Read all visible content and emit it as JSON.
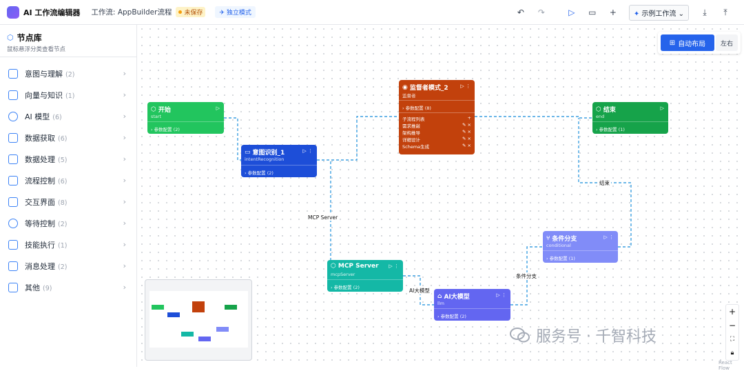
{
  "header": {
    "app_title": "AI 工作流编辑器",
    "workflow_label": "工作流: AppBuilder流程",
    "unsaved_label": "未保存",
    "mode_label": "独立模式",
    "example_workflow": "示例工作流"
  },
  "sidebar": {
    "title": "节点库",
    "subtitle": "鼠标悬浮分类查看节点",
    "items": [
      {
        "label": "意图与理解",
        "count": "(2)",
        "icon": "chat-icon"
      },
      {
        "label": "向量与知识",
        "count": "(1)",
        "icon": "cube-icon"
      },
      {
        "label": "AI 模型",
        "count": "(6)",
        "icon": "globe-icon"
      },
      {
        "label": "数据获取",
        "count": "(6)",
        "icon": "cube-icon"
      },
      {
        "label": "数据处理",
        "count": "(5)",
        "icon": "cube-icon"
      },
      {
        "label": "流程控制",
        "count": "(6)",
        "icon": "branch-icon"
      },
      {
        "label": "交互界面",
        "count": "(8)",
        "icon": "window-icon"
      },
      {
        "label": "等待控制",
        "count": "(2)",
        "icon": "timer-icon"
      },
      {
        "label": "技能执行",
        "count": "(1)",
        "icon": "robot-icon"
      },
      {
        "label": "消息处理",
        "count": "(2)",
        "icon": "chat-icon"
      },
      {
        "label": "其他",
        "count": "(9)",
        "icon": "cube-icon"
      }
    ]
  },
  "canvas": {
    "auto_layout": "自动布局",
    "direction": "左右",
    "react_flow": "React Flow",
    "watermark": "服务号 · 千智科技",
    "nodes": {
      "start": {
        "title": "开始",
        "type": "start",
        "param": "参数配置 (2)",
        "color": "#22c55e"
      },
      "intent": {
        "title": "意图识别_1",
        "type": "intentRecognition",
        "param": "参数配置 (2)",
        "color": "#1d4ed8"
      },
      "supervisor": {
        "title": "监督者模式_2",
        "type": "监督者",
        "param": "参数配置 (8)",
        "color": "#c2410c",
        "subflow_label": "子流程列表",
        "subflows": [
          "需求推敲",
          "架构推导",
          "详细设计",
          "Schema生成"
        ]
      },
      "end": {
        "title": "结束",
        "type": "end",
        "param": "参数配置 (1)",
        "color": "#16a34a"
      },
      "condition": {
        "title": "条件分支",
        "type": "conditional",
        "param": "参数配置 (1)",
        "color": "#818cf8"
      },
      "mcp": {
        "title": "MCP Server",
        "type": "mcpServer",
        "param": "参数配置 (2)",
        "color": "#14b8a6"
      },
      "llm": {
        "title": "AI大模型",
        "type": "llm",
        "param": "参数配置 (2)",
        "color": "#6366f1"
      }
    },
    "edge_labels": {
      "mcp": "MCP Server",
      "end": "结束",
      "cond": "条件分支",
      "llm": "AI大模型"
    }
  }
}
